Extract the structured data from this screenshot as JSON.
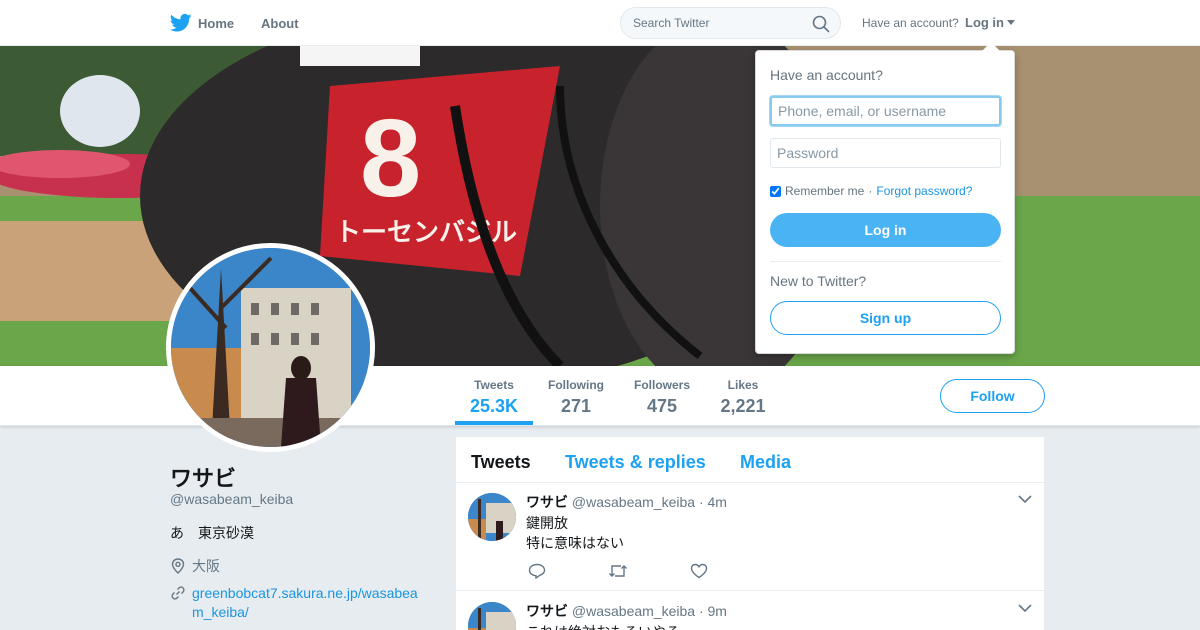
{
  "nav": {
    "home_label": "Home",
    "about_label": "About",
    "search_placeholder": "Search Twitter",
    "have_account": "Have an account?",
    "login_label": "Log in"
  },
  "profile": {
    "name": "ワサビ",
    "handle": "@wasabeam_keiba",
    "bio": "あ　東京砂漠",
    "location": "大阪",
    "url": "greenbobcat7.sakura.ne.jp/wasabeam_keiba/"
  },
  "stats": [
    {
      "label": "Tweets",
      "value": "25.3K"
    },
    {
      "label": "Following",
      "value": "271"
    },
    {
      "label": "Followers",
      "value": "475"
    },
    {
      "label": "Likes",
      "value": "2,221"
    }
  ],
  "follow_label": "Follow",
  "timeline": {
    "tabs": [
      "Tweets",
      "Tweets & replies",
      "Media"
    ],
    "tweets": [
      {
        "name": "ワサビ",
        "handle": "@wasabeam_keiba",
        "time": "4m",
        "lines": [
          "鍵開放",
          "特に意味はない"
        ]
      },
      {
        "name": "ワサビ",
        "handle": "@wasabeam_keiba",
        "time": "9m",
        "lines": [
          "これは絶対おもろいやろ"
        ]
      }
    ]
  },
  "login_dropdown": {
    "title": "Have an account?",
    "username_placeholder": "Phone, email, or username",
    "password_placeholder": "Password",
    "remember_label": "Remember me",
    "forgot_label": "Forgot password?",
    "login_button": "Log in",
    "new_prompt": "New to Twitter?",
    "signup_button": "Sign up"
  },
  "colors": {
    "brand": "#1da1f2",
    "login_button": "#4ab3f4",
    "background": "#e6ecf0"
  }
}
